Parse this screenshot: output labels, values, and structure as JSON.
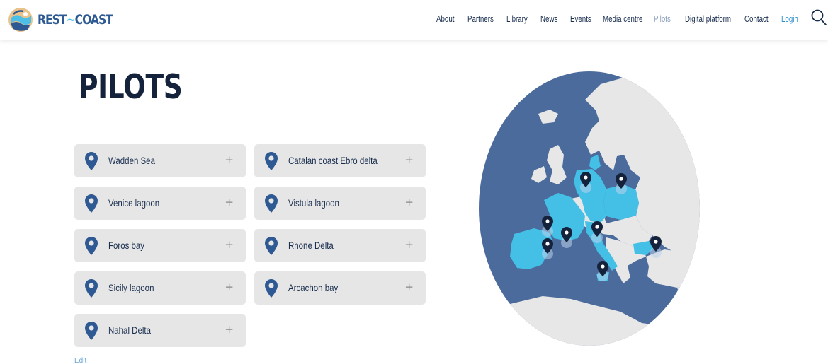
{
  "header": {
    "logo_text_main": "REST",
    "logo_text_tilde": "~",
    "logo_text_end": "COAST",
    "nav": [
      {
        "label": "About",
        "active": false,
        "color": "#1a2f50"
      },
      {
        "label": "Partners",
        "active": false,
        "color": "#1a2f50"
      },
      {
        "label": "Library",
        "active": false,
        "color": "#1a2f50"
      },
      {
        "label": "News",
        "active": false,
        "color": "#1a2f50"
      },
      {
        "label": "Events",
        "active": false,
        "color": "#1a2f50"
      },
      {
        "label": "Media centre",
        "active": false,
        "color": "#1a2f50"
      },
      {
        "label": "Pilots",
        "active": true,
        "color": "#8aa0bd"
      },
      {
        "label": "Digital platform",
        "active": false,
        "color": "#1a2f50"
      },
      {
        "label": "Contact",
        "active": false,
        "color": "#1a2f50"
      },
      {
        "label": "Login",
        "active": false,
        "color": "#2b8fd1"
      }
    ],
    "search_icon": "search-icon"
  },
  "page": {
    "title": "PILOTS",
    "edit_label": "Edit"
  },
  "pilots": [
    {
      "label": "Wadden Sea",
      "expand": "+"
    },
    {
      "label": "Catalan coast Ebro delta",
      "expand": "+"
    },
    {
      "label": "Venice lagoon",
      "expand": "+"
    },
    {
      "label": "Vistula lagoon",
      "expand": "+"
    },
    {
      "label": "Foros bay",
      "expand": "+"
    },
    {
      "label": "Rhone Delta",
      "expand": "+"
    },
    {
      "label": "Sicily lagoon",
      "expand": "+"
    },
    {
      "label": "Arcachon bay",
      "expand": "+"
    },
    {
      "label": "Nahal Delta",
      "expand": "+"
    }
  ],
  "colors": {
    "sea": "#4a6b9b",
    "land": "#e7e7e7",
    "pilot_country": "#44bfe6",
    "pin_card": "#2e5993",
    "pin_map": "#15223b",
    "title": "#15223b"
  },
  "map": {
    "icon": "europe-map-icon",
    "markers": 9
  }
}
